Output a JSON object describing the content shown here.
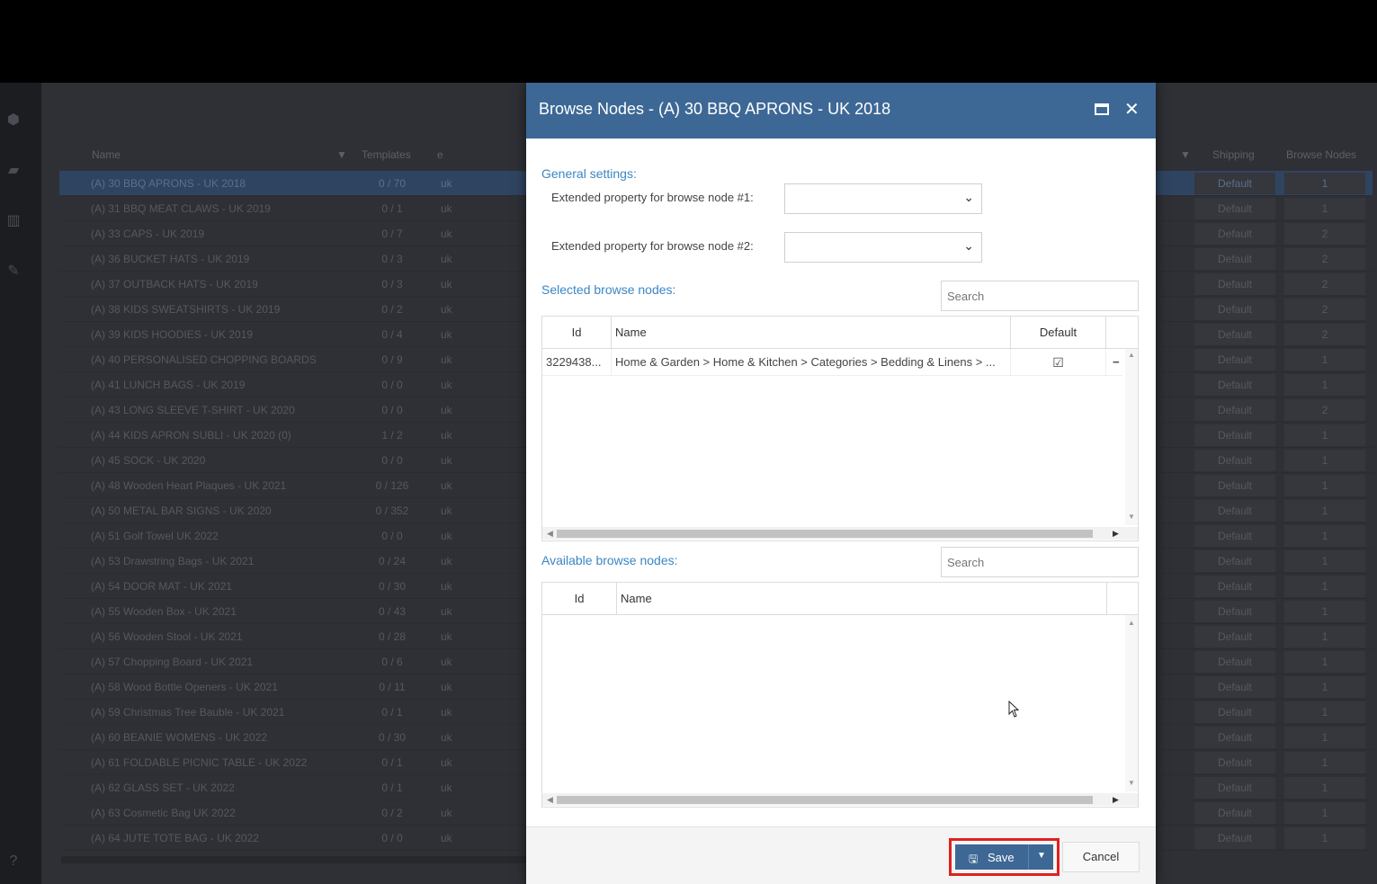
{
  "background": {
    "headers": {
      "name": "Name",
      "templates": "Templates",
      "e": "e",
      "shipping": "Shipping",
      "browse_nodes": "Browse Nodes"
    },
    "rows": [
      {
        "name": "(A) 30 BBQ APRONS - UK 2018",
        "tpl": "0 / 70",
        "uk": "uk",
        "ship": "Default",
        "bn": "1"
      },
      {
        "name": "(A) 31 BBQ MEAT CLAWS - UK 2019",
        "tpl": "0 / 1",
        "uk": "uk",
        "ship": "Default",
        "bn": "1"
      },
      {
        "name": "(A) 33 CAPS - UK 2019",
        "tpl": "0 / 7",
        "uk": "uk",
        "ship": "Default",
        "bn": "2"
      },
      {
        "name": "(A) 36 BUCKET HATS - UK 2019",
        "tpl": "0 / 3",
        "uk": "uk",
        "ship": "Default",
        "bn": "2"
      },
      {
        "name": "(A) 37 OUTBACK HATS - UK 2019",
        "tpl": "0 / 3",
        "uk": "uk",
        "ship": "Default",
        "bn": "2"
      },
      {
        "name": "(A) 38 KIDS SWEATSHIRTS - UK 2019",
        "tpl": "0 / 2",
        "uk": "uk",
        "ship": "Default",
        "bn": "2"
      },
      {
        "name": "(A) 39 KIDS HOODIES - UK 2019",
        "tpl": "0 / 4",
        "uk": "uk",
        "ship": "Default",
        "bn": "2"
      },
      {
        "name": "(A) 40 PERSONALISED CHOPPING BOARDS",
        "tpl": "0 / 9",
        "uk": "uk",
        "ship": "Default",
        "bn": "1"
      },
      {
        "name": "(A) 41 LUNCH BAGS - UK 2019",
        "tpl": "0 / 0",
        "uk": "uk",
        "ship": "Default",
        "bn": "1"
      },
      {
        "name": "(A) 43 LONG SLEEVE T-SHIRT - UK 2020",
        "tpl": "0 / 0",
        "uk": "uk",
        "ship": "Default",
        "bn": "2"
      },
      {
        "name": "(A) 44 KIDS APRON SUBLI - UK 2020 (0)",
        "tpl": "1 / 2",
        "uk": "uk",
        "ship": "Default",
        "bn": "1"
      },
      {
        "name": "(A) 45 SOCK - UK 2020",
        "tpl": "0 / 0",
        "uk": "uk",
        "ship": "Default",
        "bn": "1"
      },
      {
        "name": "(A) 48 Wooden Heart Plaques - UK 2021",
        "tpl": "0 / 126",
        "uk": "uk",
        "ship": "Default",
        "bn": "1"
      },
      {
        "name": "(A) 50 METAL BAR SIGNS - UK 2020",
        "tpl": "0 / 352",
        "uk": "uk",
        "ship": "Default",
        "bn": "1"
      },
      {
        "name": "(A) 51 Golf Towel UK 2022",
        "tpl": "0 / 0",
        "uk": "uk",
        "ship": "Default",
        "bn": "1"
      },
      {
        "name": "(A) 53 Drawstring Bags - UK 2021",
        "tpl": "0 / 24",
        "uk": "uk",
        "ship": "Default",
        "bn": "1"
      },
      {
        "name": "(A) 54 DOOR MAT - UK 2021",
        "tpl": "0 / 30",
        "uk": "uk",
        "ship": "Default",
        "bn": "1"
      },
      {
        "name": "(A) 55 Wooden Box - UK 2021",
        "tpl": "0 / 43",
        "uk": "uk",
        "ship": "Default",
        "bn": "1"
      },
      {
        "name": "(A) 56 Wooden Stool - UK 2021",
        "tpl": "0 / 28",
        "uk": "uk",
        "ship": "Default",
        "bn": "1"
      },
      {
        "name": "(A) 57 Chopping Board - UK 2021",
        "tpl": "0 / 6",
        "uk": "uk",
        "ship": "Default",
        "bn": "1"
      },
      {
        "name": "(A) 58 Wood Bottle Openers - UK 2021",
        "tpl": "0 / 11",
        "uk": "uk",
        "ship": "Default",
        "bn": "1"
      },
      {
        "name": "(A) 59 Christmas Tree Bauble - UK 2021",
        "tpl": "0 / 1",
        "uk": "uk",
        "ship": "Default",
        "bn": "1"
      },
      {
        "name": "(A) 60 BEANIE WOMENS - UK 2022",
        "tpl": "0 / 30",
        "uk": "uk",
        "ship": "Default",
        "bn": "1"
      },
      {
        "name": "(A) 61 FOLDABLE PICNIC TABLE - UK 2022",
        "tpl": "0 / 1",
        "uk": "uk",
        "ship": "Default",
        "bn": "1"
      },
      {
        "name": "(A) 62 GLASS SET - UK 2022",
        "tpl": "0 / 1",
        "uk": "uk",
        "ship": "Default",
        "bn": "1"
      },
      {
        "name": "(A) 63 Cosmetic Bag UK 2022",
        "tpl": "0 / 2",
        "uk": "uk",
        "ship": "Default",
        "bn": "1"
      },
      {
        "name": "(A) 64 JUTE TOTE BAG - UK 2022",
        "tpl": "0 / 0",
        "uk": "uk",
        "ship": "Default",
        "bn": "1"
      }
    ]
  },
  "modal": {
    "title": "Browse Nodes - (A) 30 BBQ APRONS - UK 2018",
    "general_settings": "General settings:",
    "ext_prop_1_label": "Extended property for browse node #1:",
    "ext_prop_2_label": "Extended property for browse node #2:",
    "ext_prop_1_value": "",
    "ext_prop_2_value": "",
    "selected_title": "Selected browse nodes:",
    "selected_search_placeholder": "Search",
    "selected_headers": {
      "id": "Id",
      "name": "Name",
      "default": "Default"
    },
    "selected_rows": [
      {
        "id": "3229438...",
        "name": "Home & Garden > Home & Kitchen > Categories > Bedding & Linens > ...",
        "default_checked": true
      }
    ],
    "available_title": "Available browse nodes:",
    "available_search_placeholder": "Search",
    "available_headers": {
      "id": "Id",
      "name": "Name"
    },
    "save_label": "Save",
    "cancel_label": "Cancel"
  },
  "colors": {
    "header": "#3d6896",
    "accent_text": "#3b86c4",
    "highlight": "#e02020"
  }
}
